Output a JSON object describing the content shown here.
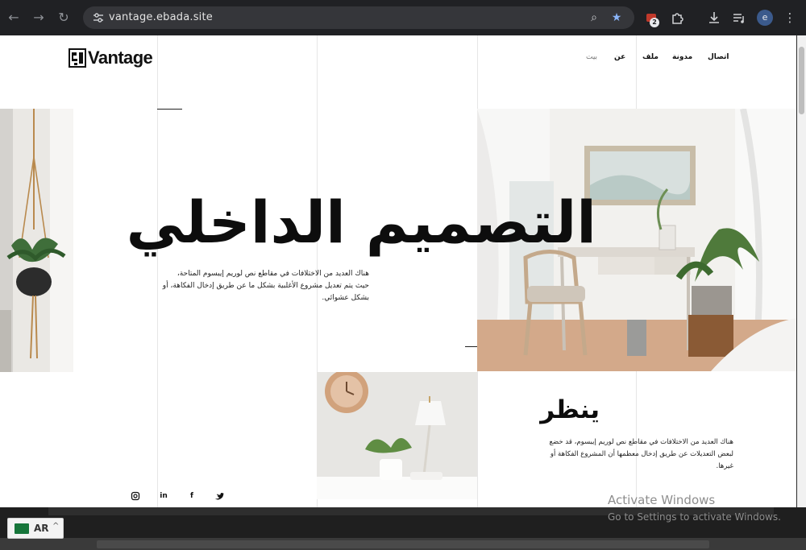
{
  "browser": {
    "url": "vantage.ebada.site",
    "extension_badge": "2",
    "profile_initial": "e"
  },
  "site": {
    "logo_text": "Vantage",
    "nav": [
      "اتصال",
      "مدونة",
      "ملف",
      "عن",
      "بيت"
    ],
    "hero_title": "التصميم الداخلي",
    "hero_text": "هناك العديد من الاختلافات في مقاطع نص لوريم إيبسوم المتاحة، حيث يتم تعديل مشروع الأغلبية بشكل ما عن طريق إدخال الفكاهة، أو بشكل عشوائي.",
    "section_title": "ينظر",
    "section_text": "هناك العديد من الاختلافات في مقاطع نص لوريم إيبسوم، قد خضع لبعض التعديلات عن طريق إدخال معظمها أن المشروع الفكاهة أو غيرها.",
    "social": [
      "instagram",
      "linkedin",
      "facebook",
      "twitter"
    ]
  },
  "system": {
    "activate_title": "Activate Windows",
    "activate_sub": "Go to Settings to activate Windows.",
    "language": "AR"
  },
  "colors": {
    "chrome_bg": "#202124",
    "omnibox_bg": "#35363a",
    "accent_star": "#8ab4f8",
    "text_dark": "#0d0d0d"
  }
}
